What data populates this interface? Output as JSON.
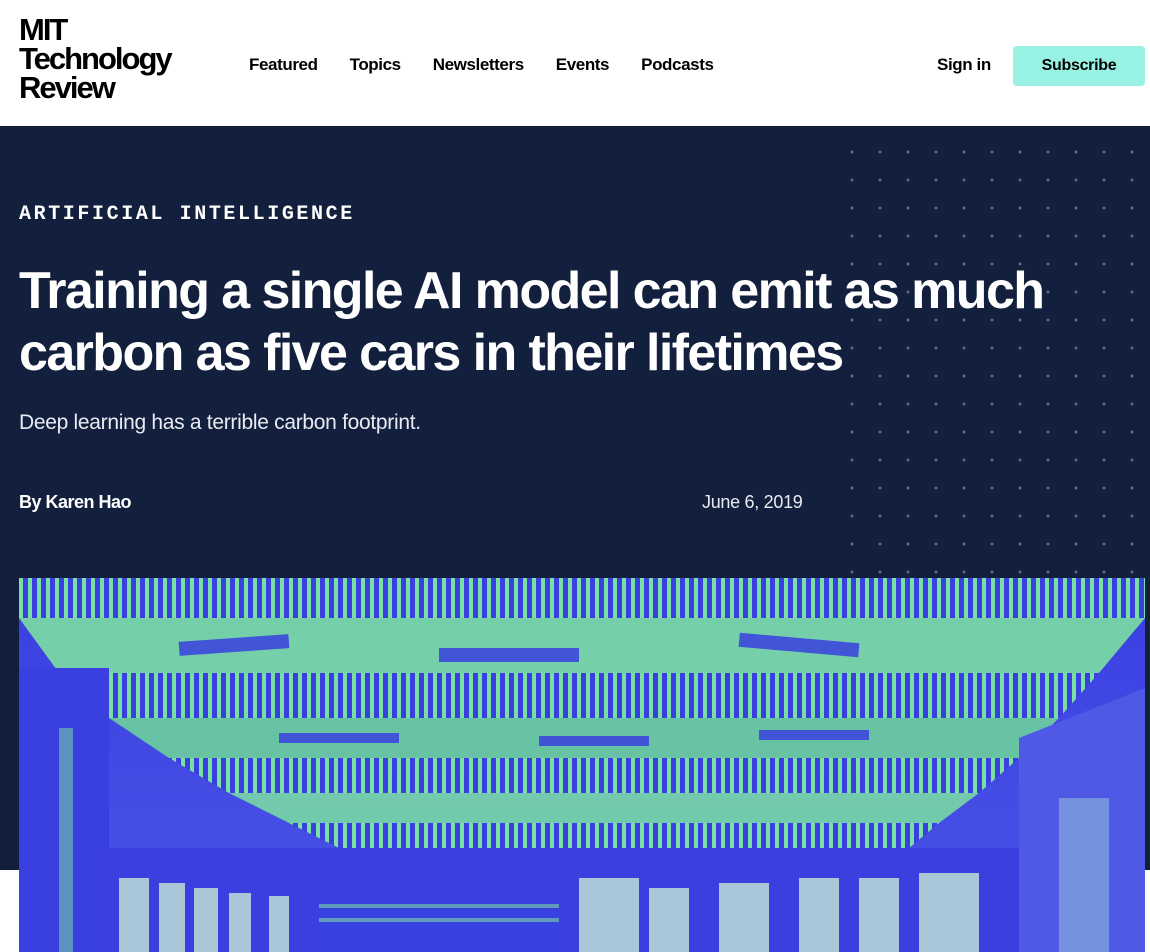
{
  "brand": {
    "logo_lines": [
      "MIT",
      "Technology",
      "Review"
    ]
  },
  "nav": {
    "items": [
      {
        "label": "Featured"
      },
      {
        "label": "Topics"
      },
      {
        "label": "Newsletters"
      },
      {
        "label": "Events"
      },
      {
        "label": "Podcasts"
      }
    ],
    "signin_label": "Sign in",
    "subscribe_label": "Subscribe"
  },
  "article": {
    "category": "ARTIFICIAL INTELLIGENCE",
    "title": "Training a single AI model can emit as much carbon as five cars in their lifetimes",
    "dek": "Deep learning has a terrible carbon footprint.",
    "byline": "By Karen Hao",
    "date": "June 6, 2019"
  },
  "colors": {
    "hero_background": "#121f3d",
    "subscribe_accent": "#98f2e3",
    "image_blue": "#3b3fe0",
    "image_green": "#7ee8a0"
  },
  "image": {
    "description_icon": "data-center-photo"
  }
}
